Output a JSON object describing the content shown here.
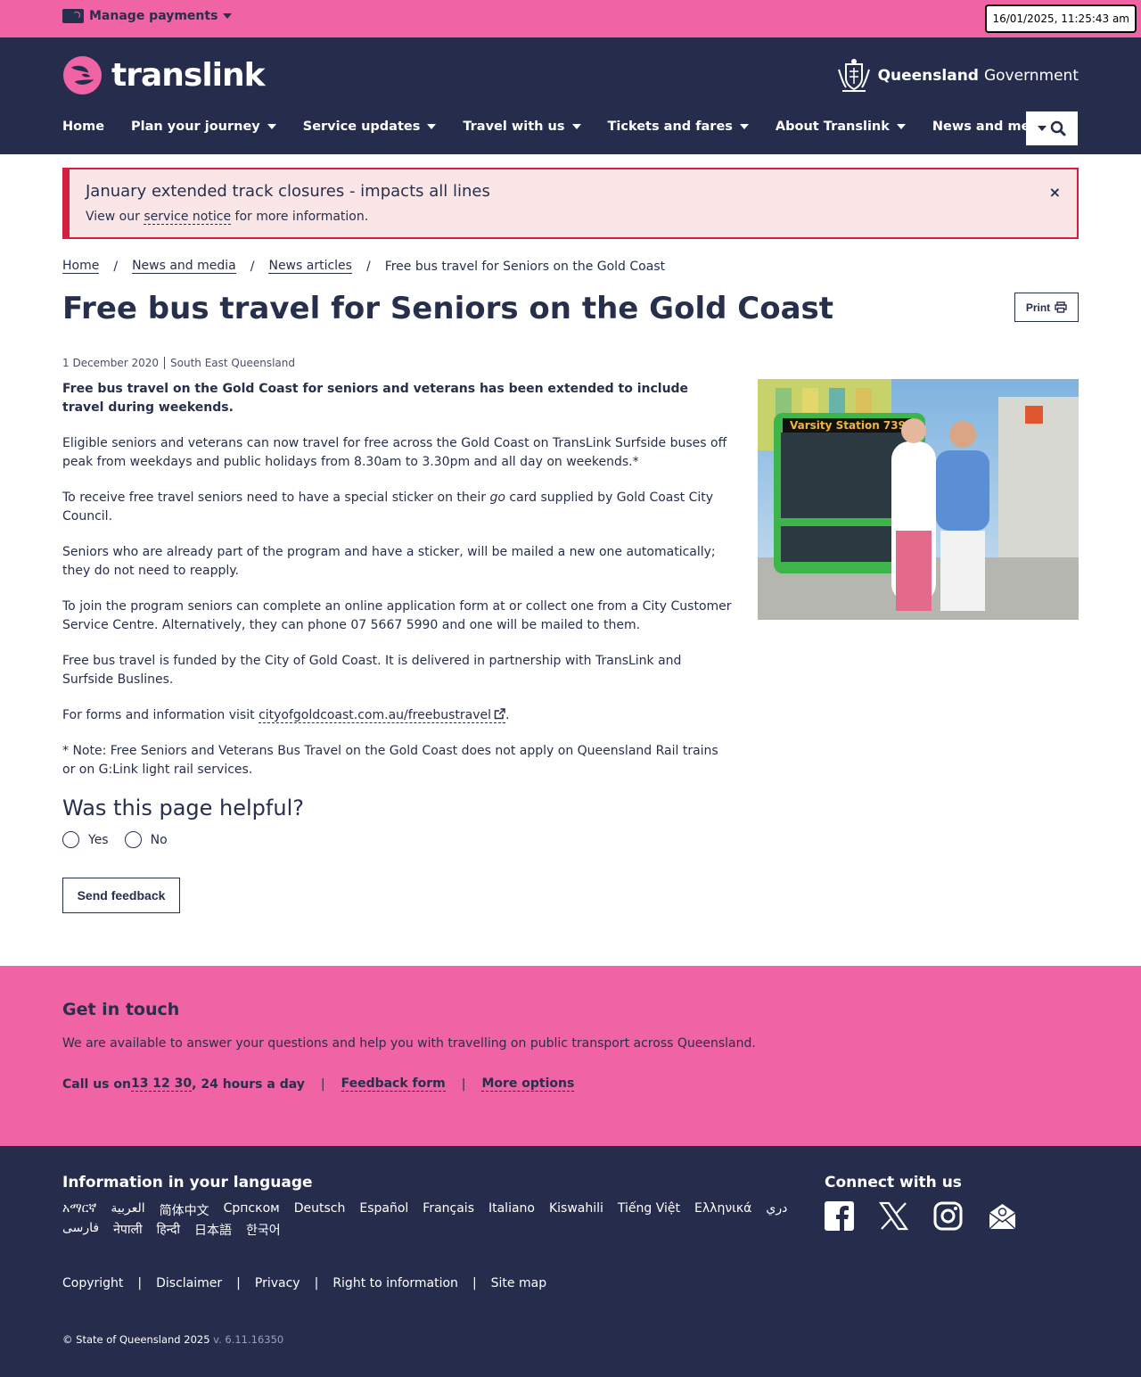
{
  "topbar": {
    "manage_label": "Manage payments",
    "clock": "16/01/2025, 11:25:43 am"
  },
  "header": {
    "logo_text": "translink",
    "gov_bold": "Queensland",
    "gov_text": "Government",
    "nav": [
      {
        "label": "Home"
      },
      {
        "label": "Plan your journey"
      },
      {
        "label": "Service updates"
      },
      {
        "label": "Travel with us"
      },
      {
        "label": "Tickets and fares"
      },
      {
        "label": "About Translink"
      },
      {
        "label": "News and media"
      }
    ]
  },
  "alert": {
    "title": "January extended track closures - impacts all lines",
    "text_before": "View our ",
    "link": "service notice",
    "text_after": " for more information.",
    "close": "×"
  },
  "breadcrumb": {
    "items": [
      "Home",
      "News and media",
      "News articles"
    ],
    "current": "Free bus travel for Seniors on the Gold Coast",
    "sep": "/"
  },
  "article": {
    "title": "Free bus travel for Seniors on the Gold Coast",
    "print_label": "Print",
    "date": "1 December 2020",
    "region": "South East Queensland",
    "lead": "Free bus travel on the Gold Coast for seniors and veterans has been extended to include travel during weekends.",
    "p1": "Eligible seniors and veterans can now travel for free across the Gold Coast on TransLink Surfside buses off peak from weekdays and public holidays from 8.30am to 3.30pm and all day on weekends.*",
    "p2_before": "To receive free travel seniors need to have a special sticker on their ",
    "p2_em": "go",
    "p2_after": " card supplied by Gold Coast City Council.",
    "p3": "Seniors who are already part of the program and have a sticker, will be mailed a new one automatically; they do not need to reapply.",
    "p4": "To join the program seniors can complete an online application form at or collect one from a City Customer Service Centre. Alternatively, they can phone 07 5667 5990 and one will be mailed to them.",
    "p5": "Free bus travel is funded by the City of Gold Coast. It is delivered in partnership with TransLink and Surfside Buslines.",
    "p6_before": "For forms and information visit ",
    "p6_link": "cityofgoldcoast.com.au/freebustravel",
    "p6_after": ".",
    "p7": "* Note: Free Seniors and Veterans Bus Travel on the Gold Coast does not apply on Queensland Rail trains or on G:Link light rail services.",
    "bus_sign": "Varsity Station 739"
  },
  "feedback": {
    "heading": "Was this page helpful?",
    "yes": "Yes",
    "no": "No",
    "send": "Send feedback"
  },
  "touch": {
    "heading": "Get in touch",
    "desc": "We are available to answer your questions and help you with travelling on public transport across Queensland.",
    "call_before": "Call us on ",
    "call_number": "13 12 30",
    "call_after": ", 24 hours a day",
    "feedback_form": "Feedback form",
    "more_options": "More options",
    "sep": "|"
  },
  "footer": {
    "lang_title": "Information in your language",
    "languages": [
      "አማርኛ",
      "العربية",
      "简体中文",
      "Српском",
      "Deutsch",
      "Español",
      "Français",
      "Italiano",
      "Kiswahili",
      "Tiếng Việt",
      "Ελληνικά",
      "دري",
      "فارسی",
      "नेपाली",
      "हिन्दी",
      "日本語",
      "한국어"
    ],
    "connect_title": "Connect with us",
    "links": [
      "Copyright",
      "Disclaimer",
      "Privacy",
      "Right to information",
      "Site map"
    ],
    "sep": "|",
    "copyright": "© State of Queensland 2025",
    "version": " v. 6.11.16350"
  },
  "colors": {
    "pink": "#f063a4",
    "navy": "#262d4c",
    "alert_red": "#d51f41",
    "alert_bg": "#fbe6e7",
    "bus_green": "#3db54a"
  }
}
